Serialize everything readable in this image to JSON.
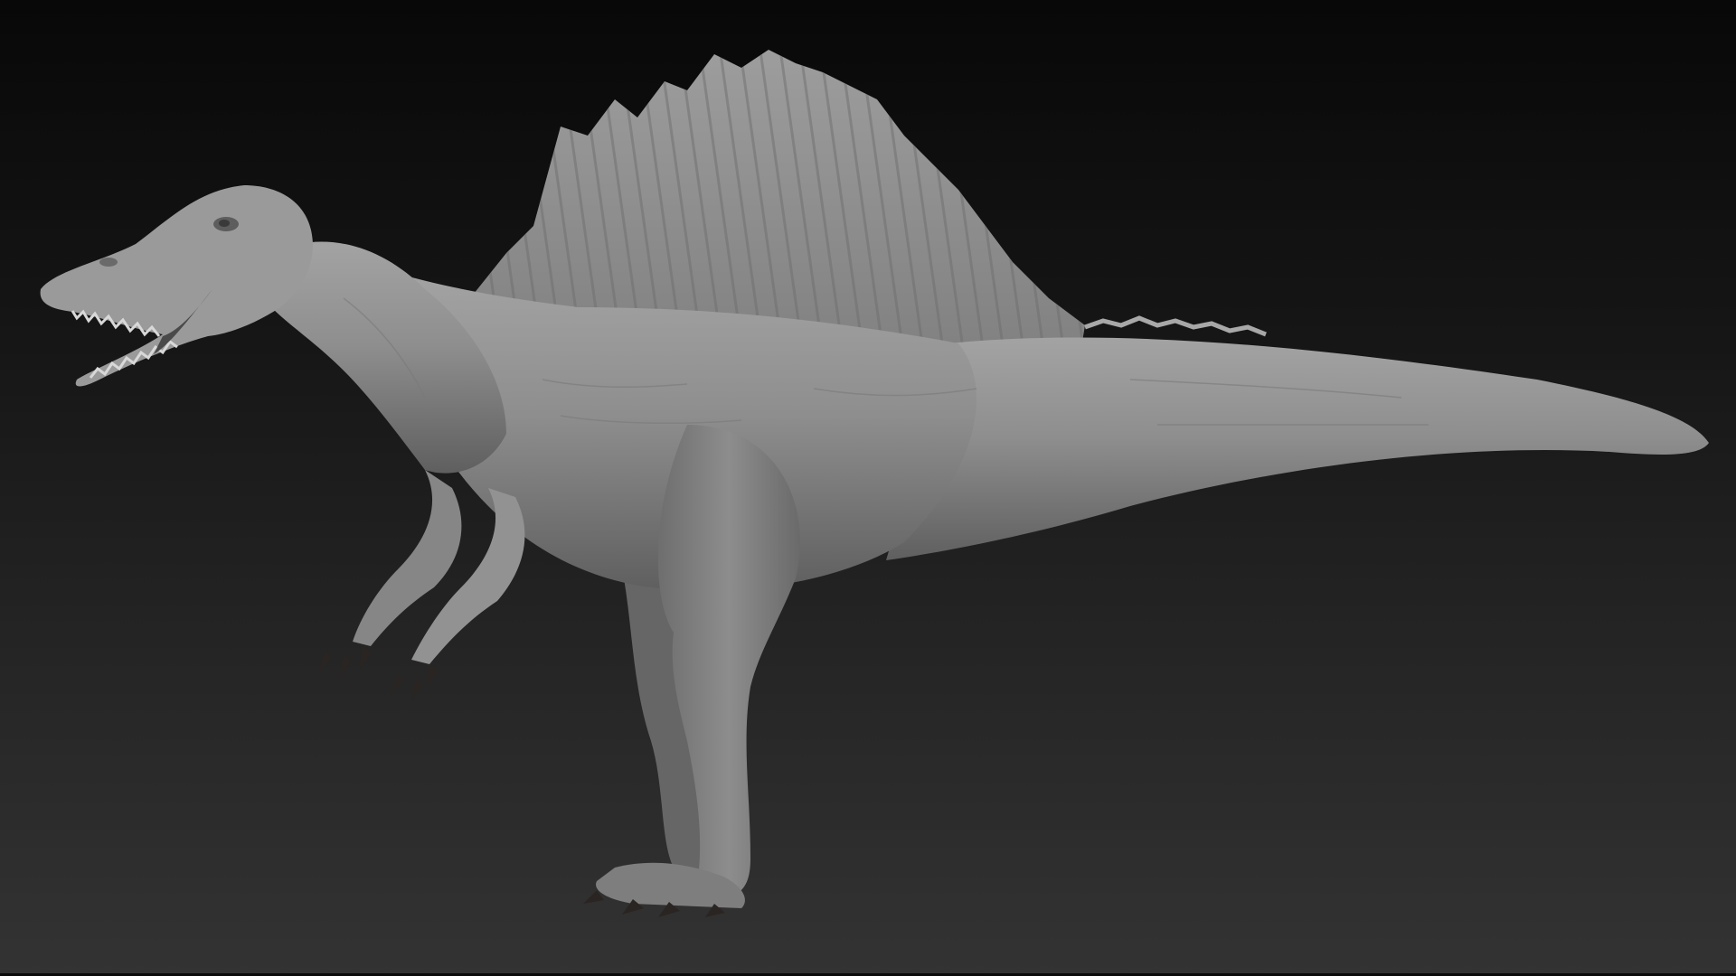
{
  "viewport": {
    "background_top": "#080808",
    "background_bottom": "#333333"
  },
  "model": {
    "subject": "spinosaurus-sculpt",
    "material_color": "#8a8a8a",
    "claw_color": "#2a2522"
  }
}
